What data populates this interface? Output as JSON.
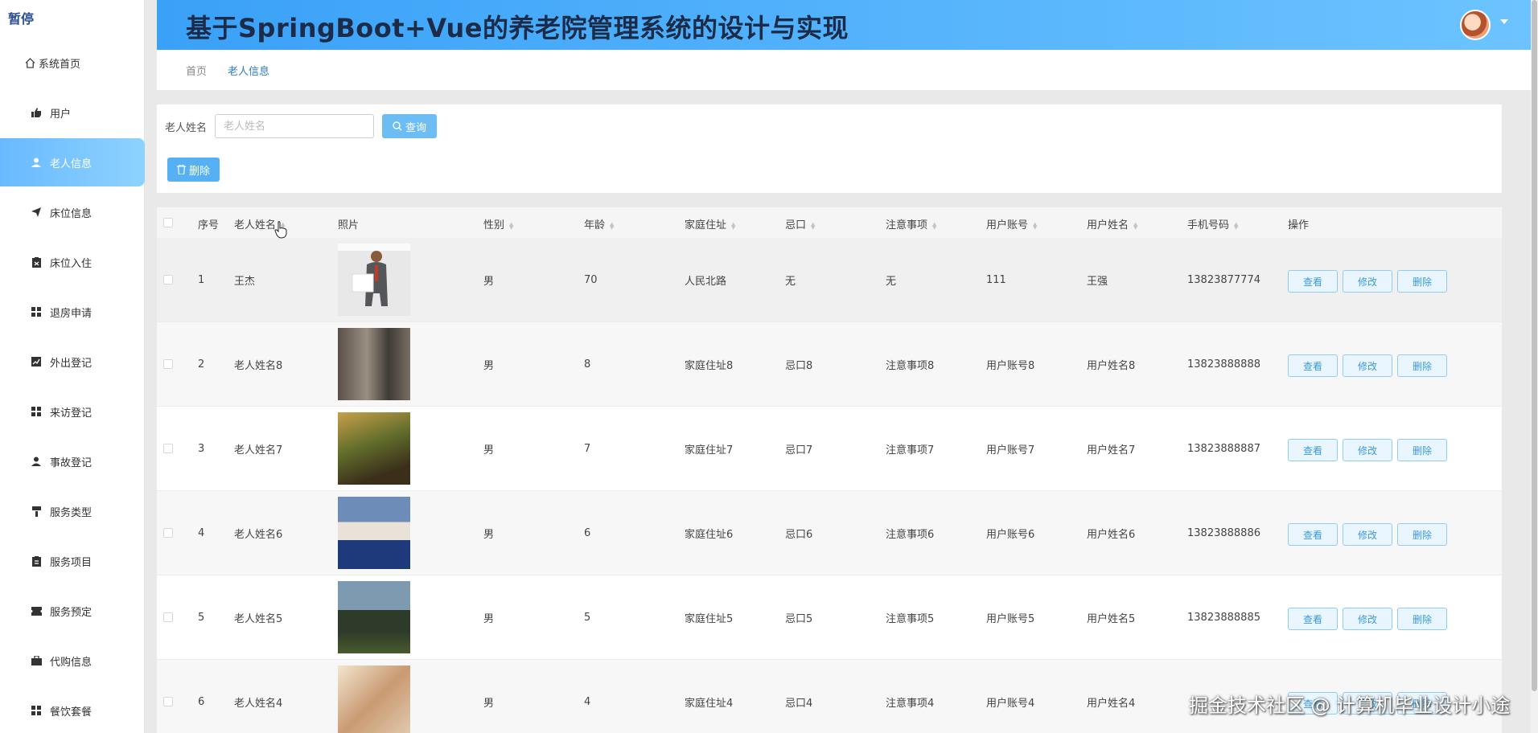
{
  "sidebar": {
    "brand": "暂停",
    "items": [
      {
        "label": "系统首页",
        "icon": "home-icon"
      },
      {
        "label": "用户",
        "icon": "thumbs-up-icon"
      },
      {
        "label": "老人信息",
        "icon": "user-icon"
      },
      {
        "label": "床位信息",
        "icon": "send-icon"
      },
      {
        "label": "床位入住",
        "icon": "clipboard-icon"
      },
      {
        "label": "退房申请",
        "icon": "grid-icon"
      },
      {
        "label": "外出登记",
        "icon": "chart-icon"
      },
      {
        "label": "来访登记",
        "icon": "grid-icon"
      },
      {
        "label": "事故登记",
        "icon": "user-icon"
      },
      {
        "label": "服务类型",
        "icon": "brush-icon"
      },
      {
        "label": "服务项目",
        "icon": "clipboard-icon"
      },
      {
        "label": "服务预定",
        "icon": "ticket-icon"
      },
      {
        "label": "代购信息",
        "icon": "briefcase-icon"
      },
      {
        "label": "餐饮套餐",
        "icon": "grid-icon"
      }
    ],
    "active_label": "老人信息"
  },
  "header": {
    "title": "基于SpringBoot+Vue的养老院管理系统的设计与实现"
  },
  "breadcrumb": {
    "home": "首页",
    "current": "老人信息"
  },
  "search": {
    "label": "老人姓名",
    "placeholder": "老人姓名",
    "query_button": "查询",
    "delete_button": "删除"
  },
  "table": {
    "columns": [
      "序号",
      "老人姓名",
      "照片",
      "性别",
      "年龄",
      "家庭住址",
      "忌口",
      "注意事项",
      "用户账号",
      "用户姓名",
      "手机号码",
      "操作"
    ],
    "actions": {
      "view": "查看",
      "edit": "修改",
      "delete": "删除"
    },
    "rows": [
      {
        "index": "1",
        "name": "王杰",
        "gender": "男",
        "age": "70",
        "address": "人民北路",
        "diet": "无",
        "notes": "无",
        "account": "111",
        "username": "王强",
        "phone": "13823877774"
      },
      {
        "index": "2",
        "name": "老人姓名8",
        "gender": "男",
        "age": "8",
        "address": "家庭住址8",
        "diet": "忌口8",
        "notes": "注意事项8",
        "account": "用户账号8",
        "username": "用户姓名8",
        "phone": "13823888888"
      },
      {
        "index": "3",
        "name": "老人姓名7",
        "gender": "男",
        "age": "7",
        "address": "家庭住址7",
        "diet": "忌口7",
        "notes": "注意事项7",
        "account": "用户账号7",
        "username": "用户姓名7",
        "phone": "13823888887"
      },
      {
        "index": "4",
        "name": "老人姓名6",
        "gender": "男",
        "age": "6",
        "address": "家庭住址6",
        "diet": "忌口6",
        "notes": "注意事项6",
        "account": "用户账号6",
        "username": "用户姓名6",
        "phone": "13823888886"
      },
      {
        "index": "5",
        "name": "老人姓名5",
        "gender": "男",
        "age": "5",
        "address": "家庭住址5",
        "diet": "忌口5",
        "notes": "注意事项5",
        "account": "用户账号5",
        "username": "用户姓名5",
        "phone": "13823888885"
      },
      {
        "index": "6",
        "name": "老人姓名4",
        "gender": "男",
        "age": "4",
        "address": "家庭住址4",
        "diet": "忌口4",
        "notes": "注意事项4",
        "account": "用户账号4",
        "username": "用户姓名4",
        "phone": ""
      }
    ]
  },
  "watermark": "掘金技术社区 @ 计算机毕业设计小途",
  "colors": {
    "accent": "#3aa1f8",
    "active_nav": "#68b9ff",
    "button_border": "#8fcbf2"
  }
}
